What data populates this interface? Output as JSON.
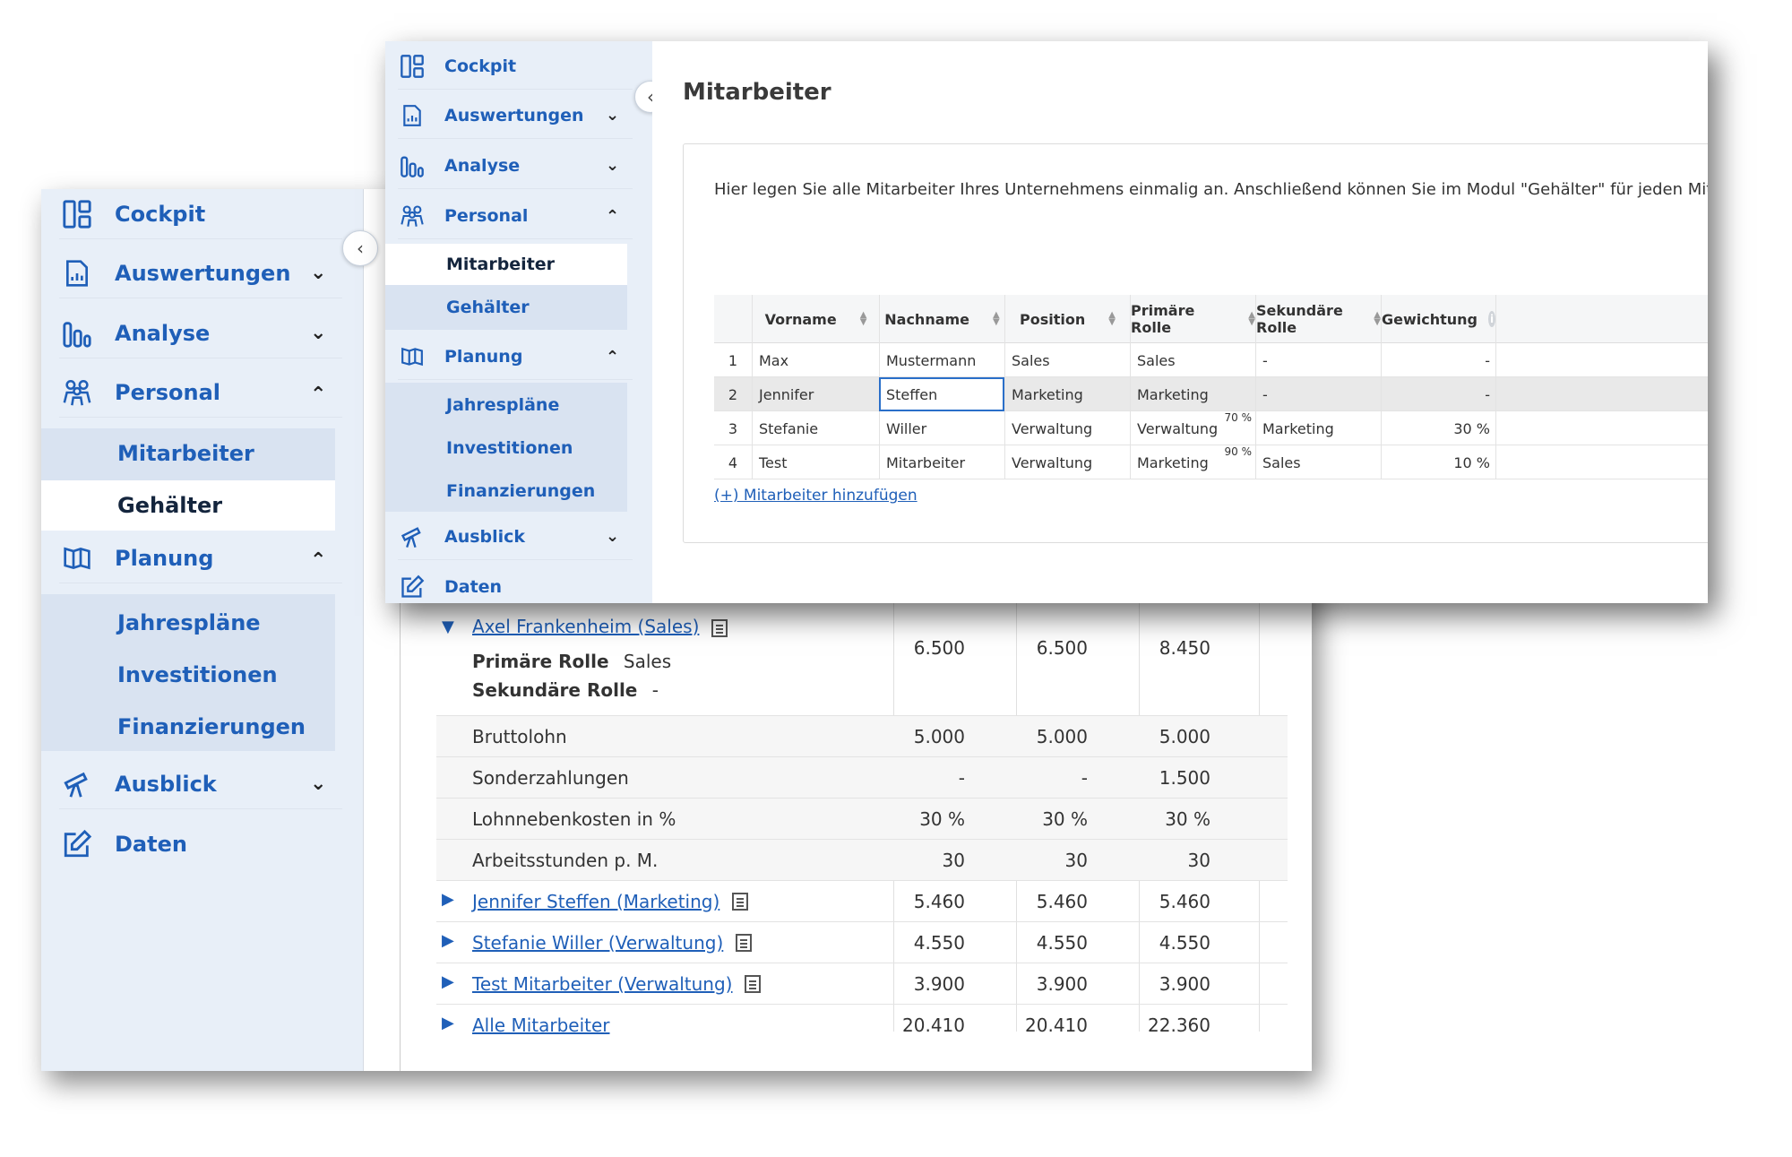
{
  "back": {
    "sidebar": {
      "items": [
        {
          "label": "Cockpit",
          "icon": "dashboard-icon"
        },
        {
          "label": "Auswertungen",
          "icon": "report-icon",
          "chevron": "⌄"
        },
        {
          "label": "Analyse",
          "icon": "bar-chart-icon",
          "chevron": "⌄"
        },
        {
          "label": "Personal",
          "icon": "people-icon",
          "chevron": "⌃"
        },
        {
          "label": "Planung",
          "icon": "book-icon",
          "chevron": "⌃"
        },
        {
          "label": "Ausblick",
          "icon": "telescope-icon",
          "chevron": "⌄"
        },
        {
          "label": "Daten",
          "icon": "edit-icon"
        }
      ],
      "personal_sub": [
        "Mitarbeiter",
        "Gehälter"
      ],
      "planung_sub": [
        "Jahrespläne",
        "Investitionen",
        "Finanzierungen"
      ]
    },
    "table": {
      "employee_header": "Axel Frankenheim (Sales)",
      "primary_label": "Primäre Rolle",
      "primary_value": "Sales",
      "secondary_label": "Sekundäre Rolle",
      "secondary_value": "-",
      "employee_values": [
        "6.500",
        "6.500",
        "8.450"
      ],
      "detail_rows": [
        {
          "label": "Bruttolohn",
          "values": [
            "5.000",
            "5.000",
            "5.000"
          ]
        },
        {
          "label": "Sonderzahlungen",
          "values": [
            "-",
            "-",
            "1.500"
          ]
        },
        {
          "label": "Lohnnebenkosten in %",
          "values": [
            "30 %",
            "30 %",
            "30 %"
          ]
        },
        {
          "label": "Arbeitsstunden p. M.",
          "values": [
            "30",
            "30",
            "30"
          ]
        }
      ],
      "employee_rows": [
        {
          "label": "Jennifer Steffen (Marketing)",
          "values": [
            "5.460",
            "5.460",
            "5.460"
          ]
        },
        {
          "label": "Stefanie Willer (Verwaltung)",
          "values": [
            "4.550",
            "4.550",
            "4.550"
          ]
        },
        {
          "label": "Test Mitarbeiter (Verwaltung)",
          "values": [
            "3.900",
            "3.900",
            "3.900"
          ]
        }
      ],
      "total_row": {
        "label": "Alle Mitarbeiter",
        "values": [
          "20.410",
          "20.410",
          "22.360"
        ]
      }
    }
  },
  "front": {
    "sidebar": {
      "items": [
        {
          "label": "Cockpit",
          "icon": "dashboard-icon"
        },
        {
          "label": "Auswertungen",
          "icon": "report-icon",
          "chevron": "⌄"
        },
        {
          "label": "Analyse",
          "icon": "bar-chart-icon",
          "chevron": "⌄"
        },
        {
          "label": "Personal",
          "icon": "people-icon",
          "chevron": "⌃"
        },
        {
          "label": "Planung",
          "icon": "book-icon",
          "chevron": "⌃"
        },
        {
          "label": "Ausblick",
          "icon": "telescope-icon",
          "chevron": "⌄"
        },
        {
          "label": "Daten",
          "icon": "edit-icon"
        }
      ],
      "personal_sub": [
        "Mitarbeiter",
        "Gehälter"
      ],
      "planung_sub": [
        "Jahrespläne",
        "Investitionen",
        "Finanzierungen"
      ]
    },
    "title": "Mitarbeiter",
    "intro": "Hier legen Sie alle Mitarbeiter Ihres Unternehmens einmalig an. Anschließend können Sie im Modul \"Gehälter\" für jeden Mitarb",
    "columns": [
      "Vorname",
      "Nachname",
      "Position",
      "Primäre Rolle",
      "Sekundäre Rolle",
      "Gewichtung"
    ],
    "rows": [
      {
        "n": "1",
        "vorname": "Max",
        "nachname": "Mustermann",
        "position": "Sales",
        "primaer": "Sales",
        "primaer_pct": "",
        "sekundaer": "-",
        "gewichtung": "-"
      },
      {
        "n": "2",
        "vorname": "Jennifer",
        "nachname": "Steffen",
        "position": "Marketing",
        "primaer": "Marketing",
        "primaer_pct": "",
        "sekundaer": "-",
        "gewichtung": "-"
      },
      {
        "n": "3",
        "vorname": "Stefanie",
        "nachname": "Willer",
        "position": "Verwaltung",
        "primaer": "Verwaltung",
        "primaer_pct": "70 %",
        "sekundaer": "Marketing",
        "gewichtung": "30 %"
      },
      {
        "n": "4",
        "vorname": "Test",
        "nachname": "Mitarbeiter",
        "position": "Verwaltung",
        "primaer": "Marketing",
        "primaer_pct": "90 %",
        "sekundaer": "Sales",
        "gewichtung": "10 %"
      }
    ],
    "add_link": "(+) Mitarbeiter hinzufügen"
  },
  "colors": {
    "accent": "#1f5fb8",
    "sidebar_bg": "#e8eff8",
    "submenu_bg": "#d9e3f1"
  }
}
